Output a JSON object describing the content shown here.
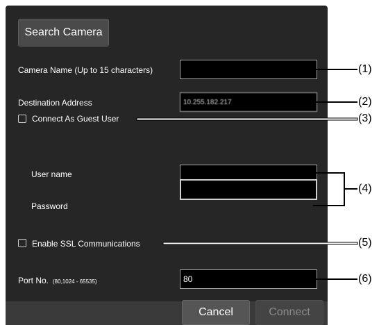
{
  "toolbar": {
    "search_label": "Search Camera"
  },
  "form": {
    "camera_name": {
      "label": "Camera Name  (Up to 15 characters)",
      "value": ""
    },
    "destination_address": {
      "label": "Destination Address",
      "value": "10.255.182.217"
    },
    "guest": {
      "label": "Connect As Guest User",
      "checked": false
    },
    "username": {
      "label": "User name",
      "value": ""
    },
    "password": {
      "label": "Password",
      "value": ""
    },
    "ssl": {
      "label": "Enable SSL Communications",
      "checked": false
    },
    "port": {
      "label": "Port No.",
      "range_hint": "(80,1024 - 65535)",
      "value": "80"
    }
  },
  "footer": {
    "cancel_label": "Cancel",
    "connect_label": "Connect"
  },
  "callouts": {
    "c1": "(1)",
    "c2": "(2)",
    "c3": "(3)",
    "c4": "(4)",
    "c5": "(5)",
    "c6": "(6)"
  },
  "colors": {
    "panel_bg": "#262626",
    "footer_bg": "#3a3a3a",
    "field_bg": "#000000",
    "field_border": "#a8a8a8",
    "disabled_text": "#8a8a8a"
  }
}
